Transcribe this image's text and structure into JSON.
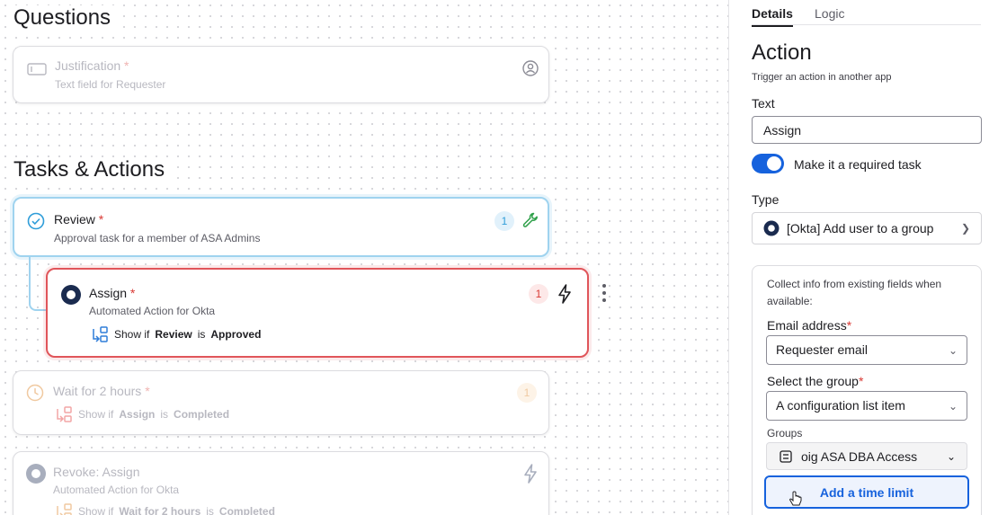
{
  "canvas": {
    "questions_title": "Questions",
    "tasks_title": "Tasks & Actions",
    "justification": {
      "title": "Justification",
      "required": "*",
      "subtitle": "Text field for Requester"
    },
    "review": {
      "title": "Review",
      "required": "*",
      "subtitle": "Approval task for a member of ASA Admins",
      "badge": "1"
    },
    "assign": {
      "title": "Assign",
      "required": "*",
      "subtitle": "Automated Action for Okta",
      "badge": "1",
      "condition": {
        "prefix": "Show if",
        "field": "Review",
        "verb": "is",
        "value": "Approved"
      }
    },
    "wait": {
      "title": "Wait for 2 hours",
      "required": "*",
      "badge": "1",
      "condition": {
        "prefix": "Show if",
        "field": "Assign",
        "verb": "is",
        "value": "Completed"
      }
    },
    "revoke": {
      "title": "Revoke: Assign",
      "subtitle": "Automated Action for Okta",
      "condition": {
        "prefix": "Show if",
        "field": "Wait for 2 hours",
        "verb": "is",
        "value": "Completed"
      }
    }
  },
  "panel": {
    "tabs": {
      "details": "Details",
      "logic": "Logic"
    },
    "heading": "Action",
    "description": "Trigger an action in another app",
    "text_label": "Text",
    "text_value": "Assign",
    "toggle_label": "Make it a required task",
    "type_label": "Type",
    "type_value": "[Okta] Add user to a group",
    "collect_info": "Collect info from existing fields when available:",
    "email_label": "Email address",
    "email_required": "*",
    "email_value": "Requester email",
    "group_label": "Select the group",
    "group_required": "*",
    "group_value": "A configuration list item",
    "groups_label": "Groups",
    "groups_value": "oig ASA DBA Access",
    "time_limit_button": "Add a time limit"
  },
  "colors": {
    "accent": "#1662dd",
    "danger": "#d93934",
    "review_border": "#9fd3ef",
    "check": "#2f9dd9",
    "okta": "#1a2b4f"
  }
}
